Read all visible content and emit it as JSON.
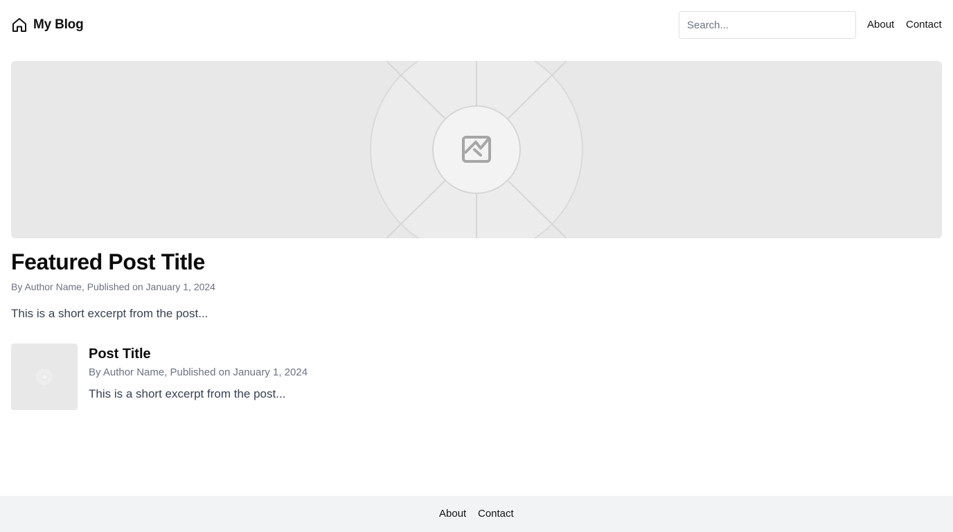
{
  "header": {
    "brand_name": "My Blog",
    "brand_icon": "home-icon",
    "search_placeholder": "Search...",
    "search_value": "",
    "nav": [
      "About",
      "Contact"
    ]
  },
  "featured": {
    "image_icon": "image-placeholder-icon",
    "title": "Featured Post Title",
    "meta": "By Author Name, Published on January 1, 2024",
    "excerpt": "This is a short excerpt from the post..."
  },
  "posts": [
    {
      "title": "Post Title",
      "meta": "By Author Name, Published on January 1, 2024",
      "excerpt": "This is a short excerpt from the post..."
    }
  ],
  "footer": {
    "links": [
      "About",
      "Contact"
    ]
  },
  "colors": {
    "placeholder_bg": "#e8e8e8",
    "footer_bg": "#f2f3f5",
    "meta_text": "#6b7280",
    "excerpt_text": "#374151"
  }
}
